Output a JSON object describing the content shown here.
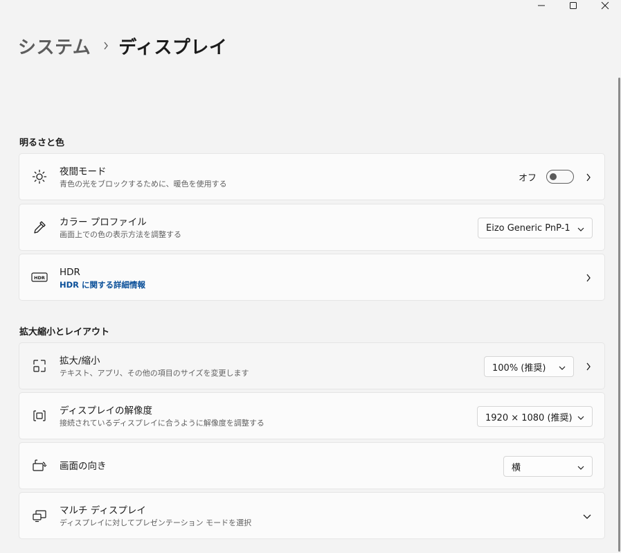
{
  "window": {
    "minimize_icon": "minimize-icon",
    "maximize_icon": "maximize-icon",
    "close_icon": "close-icon"
  },
  "breadcrumb": {
    "parent": "システム",
    "separator": "›",
    "current": "ディスプレイ"
  },
  "sections": {
    "brightness": {
      "title": "明るさと色",
      "night_mode": {
        "title": "夜間モード",
        "subtitle": "青色の光をブロックするために、暖色を使用する",
        "toggle_label": "オフ",
        "toggle_on": false,
        "icon": "brightness-sun-icon"
      },
      "color_profile": {
        "title": "カラー プロファイル",
        "subtitle": "画面上での色の表示方法を調整する",
        "value": "Eizo Generic PnP-1",
        "icon": "eyedropper-icon"
      },
      "hdr": {
        "title": "HDR",
        "link": "HDR に関する詳細情報",
        "icon": "hdr-icon"
      }
    },
    "scale_layout": {
      "title": "拡大縮小とレイアウト",
      "scale": {
        "title": "拡大/縮小",
        "subtitle": "テキスト、アプリ、その他の項目のサイズを変更します",
        "value": "100% (推奨)",
        "icon": "scale-icon"
      },
      "resolution": {
        "title": "ディスプレイの解像度",
        "subtitle": "接続されているディスプレイに合うように解像度を調整する",
        "value": "1920 × 1080 (推奨)",
        "icon": "resolution-icon"
      },
      "orientation": {
        "title": "画面の向き",
        "value": "横",
        "icon": "orientation-icon"
      },
      "multi_display": {
        "title": "マルチ ディスプレイ",
        "subtitle": "ディスプレイに対してプレゼンテーション モードを選択",
        "icon": "multi-display-icon"
      }
    }
  },
  "colors": {
    "background": "#f3f3f3",
    "card": "#fbfbfb",
    "link": "#0a4f99"
  }
}
